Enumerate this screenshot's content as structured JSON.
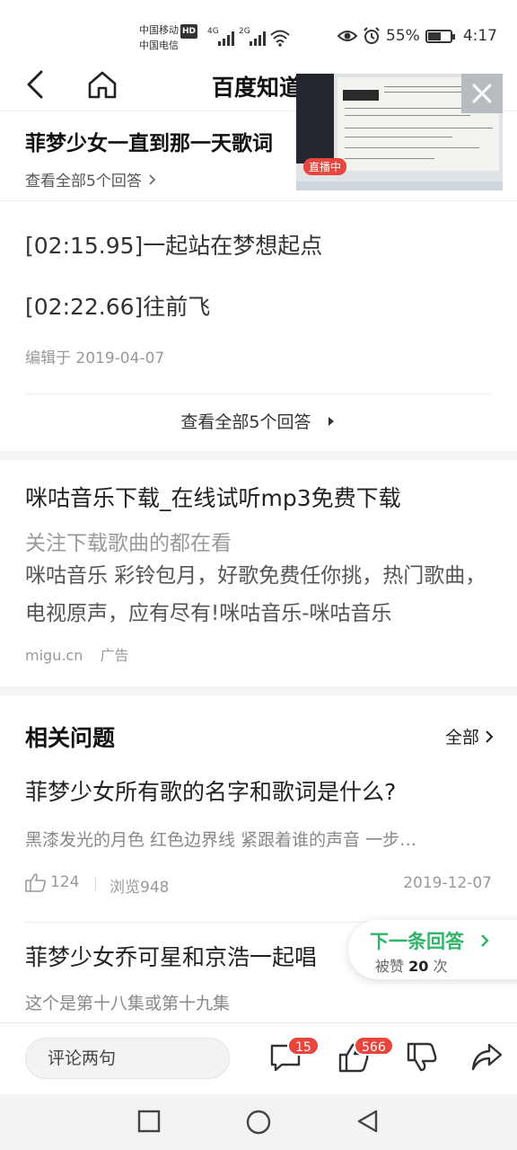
{
  "status_bar": {
    "carrier1": "中国移动",
    "carrier1_badge": "HD",
    "carrier2": "中国电信",
    "net1": "4G",
    "net2": "2G",
    "battery_percent": "55%",
    "battery_level": 0.55,
    "time": "4:17"
  },
  "nav": {
    "title": "百度知道"
  },
  "live_video": {
    "tag": "直播中"
  },
  "question_header": {
    "title": "菲梦少女一直到那一天歌词",
    "view_all": "查看全部5个回答"
  },
  "answer": {
    "lines": [
      "[02:15.95]一起站在梦想起点",
      "[02:22.66]往前飞"
    ],
    "edit_date": "编辑于 2019-04-07",
    "view_all": "查看全部5个回答"
  },
  "ad": {
    "title": "咪咕音乐下载_在线试听mp3免费下载",
    "subtitle": "关注下载歌曲的都在看",
    "description": "咪咕音乐 彩铃包月，好歌免费任你挑，热门歌曲，电视原声，应有尽有!咪咕音乐-咪咕音乐",
    "source": "migu.cn",
    "tag": "广告"
  },
  "related": {
    "heading": "相关问题",
    "all_label": "全部",
    "items": [
      {
        "question": "菲梦少女所有歌的名字和歌词是什么?",
        "excerpt": "黑漆发光的月色 红色边界线 紧跟着谁的声音 一步…",
        "likes": "124",
        "views": "浏览948",
        "date": "2019-12-07"
      },
      {
        "question": "菲梦少女乔可星和京浩一起唱",
        "excerpt": "这个是第十八集或第十九集"
      }
    ]
  },
  "next_answer": {
    "label": "下一条回答",
    "likes_prefix": "被赞",
    "likes_count": "20",
    "likes_suffix": "次"
  },
  "toolbar": {
    "comment_placeholder": "评论两句",
    "comment_count": "15",
    "like_count": "566"
  },
  "colors": {
    "accent_green": "#2fb468",
    "badge_red": "#e8453c"
  }
}
